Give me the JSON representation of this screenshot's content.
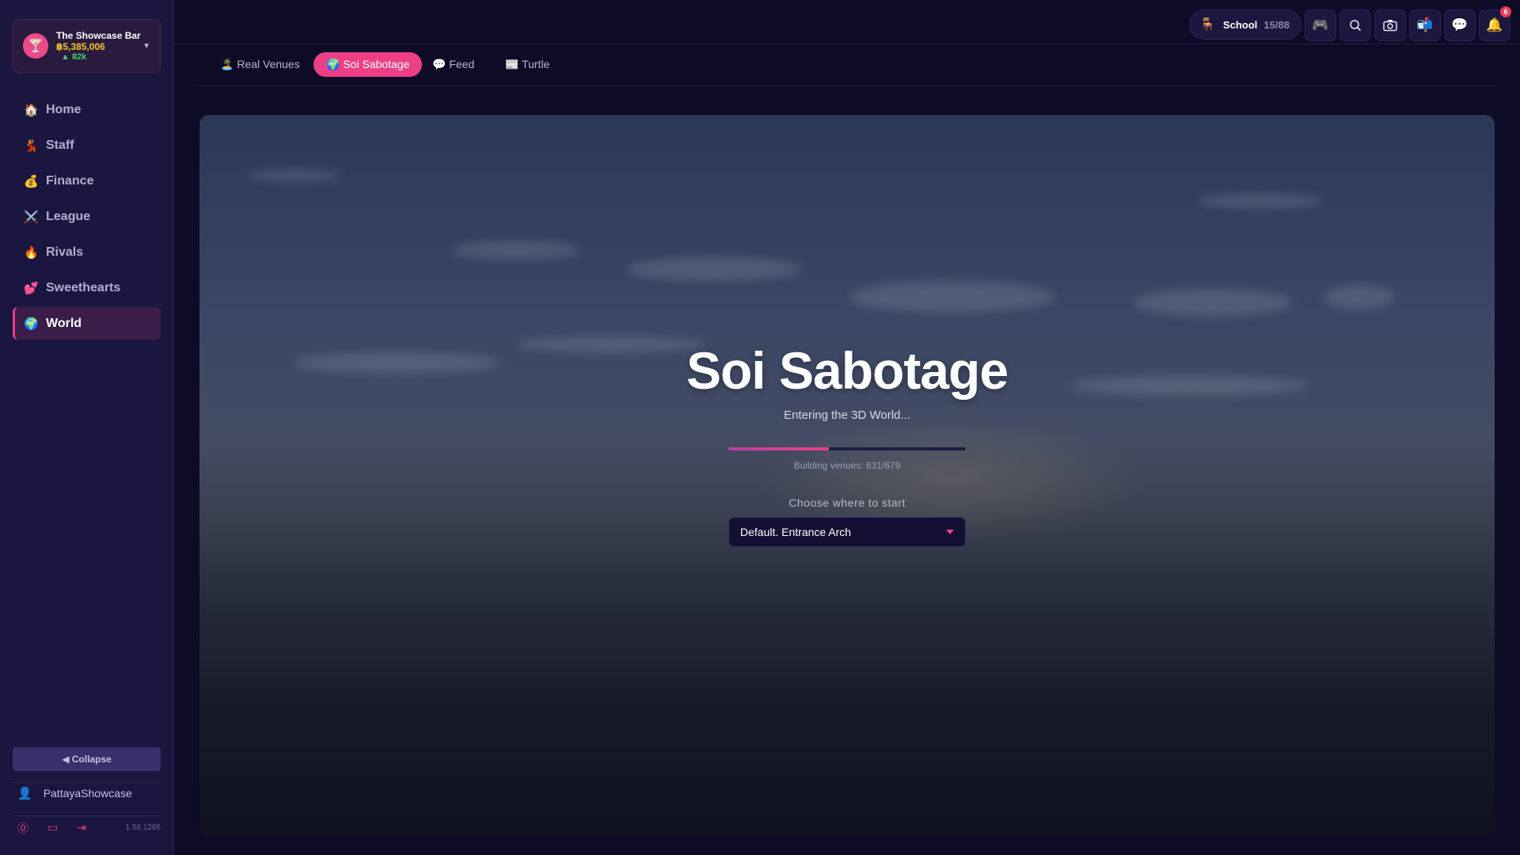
{
  "venue": {
    "name": "The Showcase Bar",
    "money": "฿5,385,006",
    "trend": "▲ 82k",
    "logo_icon": "cocktail-icon"
  },
  "nav": {
    "items": [
      {
        "icon": "🏠",
        "icon_name": "home-icon",
        "label": "Home"
      },
      {
        "icon": "💃",
        "icon_name": "dancer-icon",
        "label": "Staff"
      },
      {
        "icon": "💰",
        "icon_name": "money-bag-icon",
        "label": "Finance"
      },
      {
        "icon": "⚔️",
        "icon_name": "swords-icon",
        "label": "League"
      },
      {
        "icon": "🔥",
        "icon_name": "fire-icon",
        "label": "Rivals"
      },
      {
        "icon": "💕",
        "icon_name": "hearts-icon",
        "label": "Sweethearts"
      },
      {
        "icon": "🌍",
        "icon_name": "globe-icon",
        "label": "World"
      }
    ],
    "active": "World"
  },
  "sidebar_footer": {
    "collapse_label": "◀ Collapse",
    "username": "PattayaShowcase",
    "version": "1.56.1286"
  },
  "topbar": {
    "school_label": "School",
    "school_count": "15/88",
    "notification_count": "6"
  },
  "tabs": [
    {
      "label": "🏝️ Real Venues"
    },
    {
      "label": "🌍 Soi Sabotage",
      "active": true
    },
    {
      "label": "💬 Feed"
    },
    {
      "label": "📰 Turtle"
    }
  ],
  "world": {
    "title": "Soi Sabotage",
    "subtitle": "Entering the 3D World...",
    "progress_fraction": 0.423,
    "status": "Building venues: 631/679",
    "choose_label": "Choose where to start",
    "start_option": "Default. Entrance Arch"
  },
  "colors": {
    "accent": "#ec3f86",
    "money": "#f4c430",
    "trend_up": "#3ecf6d"
  }
}
